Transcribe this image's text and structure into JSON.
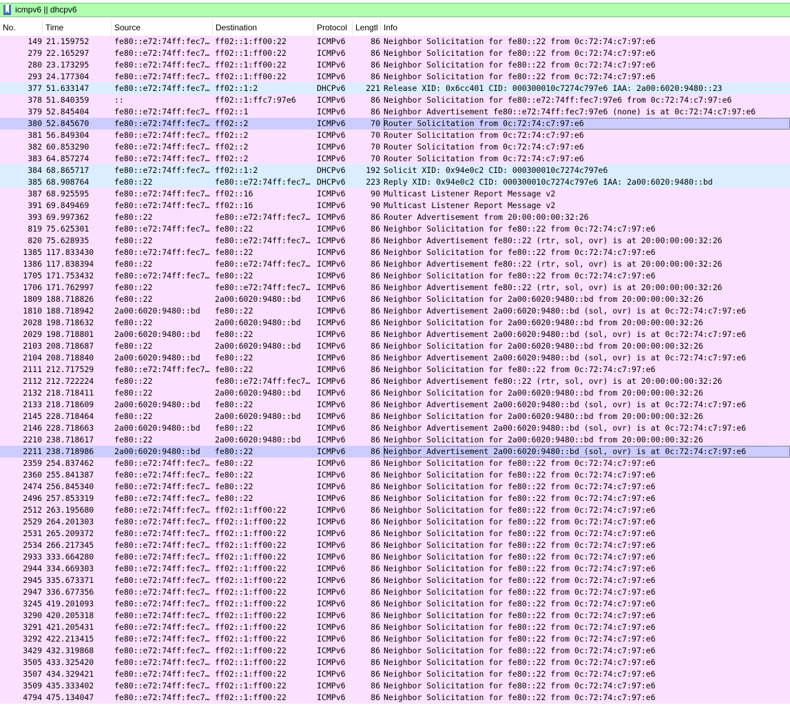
{
  "filter": {
    "value": "icmpv6 || dhcpv6"
  },
  "columns": [
    {
      "key": "no",
      "label": "No."
    },
    {
      "key": "time",
      "label": "Time"
    },
    {
      "key": "source",
      "label": "Source"
    },
    {
      "key": "destination",
      "label": "Destination"
    },
    {
      "key": "protocol",
      "label": "Protocol"
    },
    {
      "key": "length",
      "label": "Lengtl"
    },
    {
      "key": "info",
      "label": "Info"
    }
  ],
  "colors": {
    "icmpv6": "#fce0ff",
    "dhcpv6": "#daeeff",
    "selected": "#ccccff",
    "filter_ok": "#afffaf"
  },
  "packets": [
    [
      "149",
      "21.159752",
      "fe80::e72:74ff:fec7…",
      "ff02::1:ff00:22",
      "ICMPv6",
      "86",
      "Neighbor Solicitation for fe80::22 from 0c:72:74:c7:97:e6"
    ],
    [
      "279",
      "22.165297",
      "fe80::e72:74ff:fec7…",
      "ff02::1:ff00:22",
      "ICMPv6",
      "86",
      "Neighbor Solicitation for fe80::22 from 0c:72:74:c7:97:e6"
    ],
    [
      "280",
      "23.173295",
      "fe80::e72:74ff:fec7…",
      "ff02::1:ff00:22",
      "ICMPv6",
      "86",
      "Neighbor Solicitation for fe80::22 from 0c:72:74:c7:97:e6"
    ],
    [
      "293",
      "24.177304",
      "fe80::e72:74ff:fec7…",
      "ff02::1:ff00:22",
      "ICMPv6",
      "86",
      "Neighbor Solicitation for fe80::22 from 0c:72:74:c7:97:e6"
    ],
    [
      "377",
      "51.633147",
      "fe80::e72:74ff:fec7…",
      "ff02::1:2",
      "DHCPv6",
      "221",
      "Release XID: 0x6cc401 CID: 000300010c7274c797e6 IAA: 2a00:6020:9480::23"
    ],
    [
      "378",
      "51.840359",
      "::",
      "ff02::1:ffc7:97e6",
      "ICMPv6",
      "86",
      "Neighbor Solicitation for fe80::e72:74ff:fec7:97e6 from 0c:72:74:c7:97:e6"
    ],
    [
      "379",
      "52.845404",
      "fe80::e72:74ff:fec7…",
      "ff02::1",
      "ICMPv6",
      "86",
      "Neighbor Advertisement fe80::e72:74ff:fec7:97e6 (none) is at 0c:72:74:c7:97:e6"
    ],
    [
      "380",
      "52.845670",
      "fe80::e72:74ff:fec7…",
      "ff02::2",
      "ICMPv6",
      "70",
      "Router Solicitation from 0c:72:74:c7:97:e6"
    ],
    [
      "381",
      "56.849304",
      "fe80::e72:74ff:fec7…",
      "ff02::2",
      "ICMPv6",
      "70",
      "Router Solicitation from 0c:72:74:c7:97:e6"
    ],
    [
      "382",
      "60.853290",
      "fe80::e72:74ff:fec7…",
      "ff02::2",
      "ICMPv6",
      "70",
      "Router Solicitation from 0c:72:74:c7:97:e6"
    ],
    [
      "383",
      "64.857274",
      "fe80::e72:74ff:fec7…",
      "ff02::2",
      "ICMPv6",
      "70",
      "Router Solicitation from 0c:72:74:c7:97:e6"
    ],
    [
      "384",
      "68.865717",
      "fe80::e72:74ff:fec7…",
      "ff02::1:2",
      "DHCPv6",
      "192",
      "Solicit XID: 0x94e0c2 CID: 000300010c7274c797e6"
    ],
    [
      "385",
      "68.908764",
      "fe80::22",
      "fe80::e72:74ff:fec7…",
      "DHCPv6",
      "223",
      "Reply XID: 0x94e0c2 CID: 000300010c7274c797e6 IAA: 2a00:6020:9480::bd"
    ],
    [
      "387",
      "68.925595",
      "fe80::e72:74ff:fec7…",
      "ff02::16",
      "ICMPv6",
      "90",
      "Multicast Listener Report Message v2"
    ],
    [
      "391",
      "69.849469",
      "fe80::e72:74ff:fec7…",
      "ff02::16",
      "ICMPv6",
      "90",
      "Multicast Listener Report Message v2"
    ],
    [
      "393",
      "69.997362",
      "fe80::22",
      "fe80::e72:74ff:fec7…",
      "ICMPv6",
      "86",
      "Router Advertisement from 20:00:00:00:32:26"
    ],
    [
      "819",
      "75.625301",
      "fe80::e72:74ff:fec7…",
      "fe80::22",
      "ICMPv6",
      "86",
      "Neighbor Solicitation for fe80::22 from 0c:72:74:c7:97:e6"
    ],
    [
      "820",
      "75.628935",
      "fe80::22",
      "fe80::e72:74ff:fec7…",
      "ICMPv6",
      "86",
      "Neighbor Advertisement fe80::22 (rtr, sol, ovr) is at 20:00:00:00:32:26"
    ],
    [
      "1385",
      "117.833430",
      "fe80::e72:74ff:fec7…",
      "fe80::22",
      "ICMPv6",
      "86",
      "Neighbor Solicitation for fe80::22 from 0c:72:74:c7:97:e6"
    ],
    [
      "1386",
      "117.838394",
      "fe80::22",
      "fe80::e72:74ff:fec7…",
      "ICMPv6",
      "86",
      "Neighbor Advertisement fe80::22 (rtr, sol, ovr) is at 20:00:00:00:32:26"
    ],
    [
      "1705",
      "171.753432",
      "fe80::e72:74ff:fec7…",
      "fe80::22",
      "ICMPv6",
      "86",
      "Neighbor Solicitation for fe80::22 from 0c:72:74:c7:97:e6"
    ],
    [
      "1706",
      "171.762997",
      "fe80::22",
      "fe80::e72:74ff:fec7…",
      "ICMPv6",
      "86",
      "Neighbor Advertisement fe80::22 (rtr, sol, ovr) is at 20:00:00:00:32:26"
    ],
    [
      "1809",
      "188.718826",
      "fe80::22",
      "2a00:6020:9480::bd",
      "ICMPv6",
      "86",
      "Neighbor Solicitation for 2a00:6020:9480::bd from 20:00:00:00:32:26"
    ],
    [
      "1810",
      "188.718942",
      "2a00:6020:9480::bd",
      "fe80::22",
      "ICMPv6",
      "86",
      "Neighbor Advertisement 2a00:6020:9480::bd (sol, ovr) is at 0c:72:74:c7:97:e6"
    ],
    [
      "2028",
      "198.718632",
      "fe80::22",
      "2a00:6020:9480::bd",
      "ICMPv6",
      "86",
      "Neighbor Solicitation for 2a00:6020:9480::bd from 20:00:00:00:32:26"
    ],
    [
      "2029",
      "198.718801",
      "2a00:6020:9480::bd",
      "fe80::22",
      "ICMPv6",
      "86",
      "Neighbor Advertisement 2a00:6020:9480::bd (sol, ovr) is at 0c:72:74:c7:97:e6"
    ],
    [
      "2103",
      "208.718687",
      "fe80::22",
      "2a00:6020:9480::bd",
      "ICMPv6",
      "86",
      "Neighbor Solicitation for 2a00:6020:9480::bd from 20:00:00:00:32:26"
    ],
    [
      "2104",
      "208.718840",
      "2a00:6020:9480::bd",
      "fe80::22",
      "ICMPv6",
      "86",
      "Neighbor Advertisement 2a00:6020:9480::bd (sol, ovr) is at 0c:72:74:c7:97:e6"
    ],
    [
      "2111",
      "212.717529",
      "fe80::e72:74ff:fec7…",
      "fe80::22",
      "ICMPv6",
      "86",
      "Neighbor Solicitation for fe80::22 from 0c:72:74:c7:97:e6"
    ],
    [
      "2112",
      "212.722224",
      "fe80::22",
      "fe80::e72:74ff:fec7…",
      "ICMPv6",
      "86",
      "Neighbor Advertisement fe80::22 (rtr, sol, ovr) is at 20:00:00:00:32:26"
    ],
    [
      "2132",
      "218.718411",
      "fe80::22",
      "2a00:6020:9480::bd",
      "ICMPv6",
      "86",
      "Neighbor Solicitation for 2a00:6020:9480::bd from 20:00:00:00:32:26"
    ],
    [
      "2133",
      "218.718609",
      "2a00:6020:9480::bd",
      "fe80::22",
      "ICMPv6",
      "86",
      "Neighbor Advertisement 2a00:6020:9480::bd (sol, ovr) is at 0c:72:74:c7:97:e6"
    ],
    [
      "2145",
      "228.718464",
      "fe80::22",
      "2a00:6020:9480::bd",
      "ICMPv6",
      "86",
      "Neighbor Solicitation for 2a00:6020:9480::bd from 20:00:00:00:32:26"
    ],
    [
      "2146",
      "228.718663",
      "2a00:6020:9480::bd",
      "fe80::22",
      "ICMPv6",
      "86",
      "Neighbor Advertisement 2a00:6020:9480::bd (sol, ovr) is at 0c:72:74:c7:97:e6"
    ],
    [
      "2210",
      "238.718617",
      "fe80::22",
      "2a00:6020:9480::bd",
      "ICMPv6",
      "86",
      "Neighbor Solicitation for 2a00:6020:9480::bd from 20:00:00:00:32:26"
    ],
    [
      "2211",
      "238.718986",
      "2a00:6020:9480::bd",
      "fe80::22",
      "ICMPv6",
      "86",
      "Neighbor Advertisement 2a00:6020:9480::bd (sol, ovr) is at 0c:72:74:c7:97:e6"
    ],
    [
      "2359",
      "254.837462",
      "fe80::e72:74ff:fec7…",
      "fe80::22",
      "ICMPv6",
      "86",
      "Neighbor Solicitation for fe80::22 from 0c:72:74:c7:97:e6"
    ],
    [
      "2360",
      "255.841387",
      "fe80::e72:74ff:fec7…",
      "fe80::22",
      "ICMPv6",
      "86",
      "Neighbor Solicitation for fe80::22 from 0c:72:74:c7:97:e6"
    ],
    [
      "2474",
      "256.845340",
      "fe80::e72:74ff:fec7…",
      "fe80::22",
      "ICMPv6",
      "86",
      "Neighbor Solicitation for fe80::22 from 0c:72:74:c7:97:e6"
    ],
    [
      "2496",
      "257.853319",
      "fe80::e72:74ff:fec7…",
      "fe80::22",
      "ICMPv6",
      "86",
      "Neighbor Solicitation for fe80::22 from 0c:72:74:c7:97:e6"
    ],
    [
      "2512",
      "263.195680",
      "fe80::e72:74ff:fec7…",
      "ff02::1:ff00:22",
      "ICMPv6",
      "86",
      "Neighbor Solicitation for fe80::22 from 0c:72:74:c7:97:e6"
    ],
    [
      "2529",
      "264.201303",
      "fe80::e72:74ff:fec7…",
      "ff02::1:ff00:22",
      "ICMPv6",
      "86",
      "Neighbor Solicitation for fe80::22 from 0c:72:74:c7:97:e6"
    ],
    [
      "2531",
      "265.209372",
      "fe80::e72:74ff:fec7…",
      "ff02::1:ff00:22",
      "ICMPv6",
      "86",
      "Neighbor Solicitation for fe80::22 from 0c:72:74:c7:97:e6"
    ],
    [
      "2534",
      "266.217345",
      "fe80::e72:74ff:fec7…",
      "ff02::1:ff00:22",
      "ICMPv6",
      "86",
      "Neighbor Solicitation for fe80::22 from 0c:72:74:c7:97:e6"
    ],
    [
      "2933",
      "333.664280",
      "fe80::e72:74ff:fec7…",
      "ff02::1:ff00:22",
      "ICMPv6",
      "86",
      "Neighbor Solicitation for fe80::22 from 0c:72:74:c7:97:e6"
    ],
    [
      "2944",
      "334.669303",
      "fe80::e72:74ff:fec7…",
      "ff02::1:ff00:22",
      "ICMPv6",
      "86",
      "Neighbor Solicitation for fe80::22 from 0c:72:74:c7:97:e6"
    ],
    [
      "2945",
      "335.673371",
      "fe80::e72:74ff:fec7…",
      "ff02::1:ff00:22",
      "ICMPv6",
      "86",
      "Neighbor Solicitation for fe80::22 from 0c:72:74:c7:97:e6"
    ],
    [
      "2947",
      "336.677356",
      "fe80::e72:74ff:fec7…",
      "ff02::1:ff00:22",
      "ICMPv6",
      "86",
      "Neighbor Solicitation for fe80::22 from 0c:72:74:c7:97:e6"
    ],
    [
      "3245",
      "419.201093",
      "fe80::e72:74ff:fec7…",
      "ff02::1:ff00:22",
      "ICMPv6",
      "86",
      "Neighbor Solicitation for fe80::22 from 0c:72:74:c7:97:e6"
    ],
    [
      "3290",
      "420.205318",
      "fe80::e72:74ff:fec7…",
      "ff02::1:ff00:22",
      "ICMPv6",
      "86",
      "Neighbor Solicitation for fe80::22 from 0c:72:74:c7:97:e6"
    ],
    [
      "3291",
      "421.205431",
      "fe80::e72:74ff:fec7…",
      "ff02::1:ff00:22",
      "ICMPv6",
      "86",
      "Neighbor Solicitation for fe80::22 from 0c:72:74:c7:97:e6"
    ],
    [
      "3292",
      "422.213415",
      "fe80::e72:74ff:fec7…",
      "ff02::1:ff00:22",
      "ICMPv6",
      "86",
      "Neighbor Solicitation for fe80::22 from 0c:72:74:c7:97:e6"
    ],
    [
      "3429",
      "432.319868",
      "fe80::e72:74ff:fec7…",
      "ff02::1:ff00:22",
      "ICMPv6",
      "86",
      "Neighbor Solicitation for fe80::22 from 0c:72:74:c7:97:e6"
    ],
    [
      "3505",
      "433.325420",
      "fe80::e72:74ff:fec7…",
      "ff02::1:ff00:22",
      "ICMPv6",
      "86",
      "Neighbor Solicitation for fe80::22 from 0c:72:74:c7:97:e6"
    ],
    [
      "3507",
      "434.329421",
      "fe80::e72:74ff:fec7…",
      "ff02::1:ff00:22",
      "ICMPv6",
      "86",
      "Neighbor Solicitation for fe80::22 from 0c:72:74:c7:97:e6"
    ],
    [
      "3509",
      "435.333402",
      "fe80::e72:74ff:fec7…",
      "ff02::1:ff00:22",
      "ICMPv6",
      "86",
      "Neighbor Solicitation for fe80::22 from 0c:72:74:c7:97:e6"
    ],
    [
      "4794",
      "475.134047",
      "fe80::e72:74ff:fec7…",
      "ff02::1:ff00:22",
      "ICMPv6",
      "86",
      "Neighbor Solicitation for fe80::22 from 0c:72:74:c7:97:e6"
    ]
  ],
  "selected_rows": [
    "380",
    "2211"
  ]
}
